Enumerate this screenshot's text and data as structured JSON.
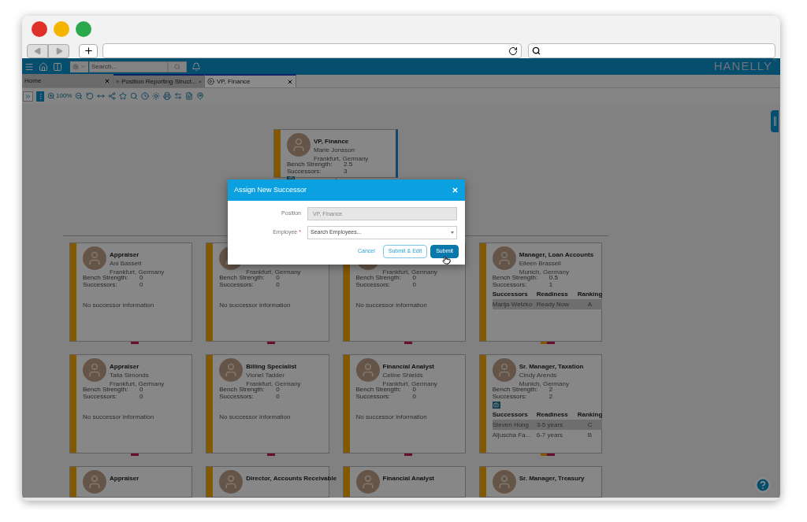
{
  "header": {
    "search_placeholder": "Search...",
    "logo": "HANELLY",
    "logo_mark": "™"
  },
  "tabs": [
    {
      "label": "Home",
      "kind": "home",
      "selected": false
    },
    {
      "label": "Position Reporting Struct...",
      "kind": "page",
      "selected": false
    },
    {
      "label": "VP, Finance",
      "kind": "page",
      "selected": true
    }
  ],
  "toolbar": {
    "zoom": "100%"
  },
  "org_chart": {
    "root": {
      "title": "VP, Finance",
      "name": "Marie Jonsson",
      "location": "Frankfurt, Germany",
      "selected": true,
      "flagged": true,
      "fields": [
        {
          "label": "Bench Strength:",
          "value": "2.5"
        },
        {
          "label": "Successors:",
          "value": "3"
        }
      ]
    },
    "rows": [
      [
        {
          "title": "Appraiser",
          "name": "Ani Bassett",
          "location": "Frankfurt, Germany",
          "selected": false,
          "flagged": false,
          "fields": [
            {
              "label": "Bench Strength:",
              "value": "0"
            },
            {
              "label": "Successors:",
              "value": "0"
            }
          ],
          "note": "No successor information"
        },
        {
          "location": "Frankfurt, Germany",
          "selected": false,
          "flagged": false,
          "fields": [
            {
              "label": "Bench Strength:",
              "value": "0"
            },
            {
              "label": "Successors:",
              "value": "0"
            }
          ],
          "note": "No successor information"
        },
        {
          "location": "Frankfurt, Germany",
          "selected": false,
          "flagged": false,
          "fields": [
            {
              "label": "Bench Strength:",
              "value": "0"
            },
            {
              "label": "Successors:",
              "value": "0"
            }
          ],
          "note": "No successor information"
        },
        {
          "title": "Manager, Loan Accounts",
          "name": "Eileen Brassell",
          "location": "Munich, Germany",
          "selected": false,
          "flagged": false,
          "fields": [
            {
              "label": "Bench Strength:",
              "value": "0.5"
            },
            {
              "label": "Successors:",
              "value": "1"
            }
          ],
          "successor_table": {
            "columns": [
              "Successors",
              "Readiness",
              "Ranking"
            ],
            "rows": [
              {
                "cells": [
                  "Marija Wetzko",
                  "Ready Now",
                  "A"
                ],
                "selected": true
              }
            ]
          }
        }
      ],
      [
        {
          "title": "Appraiser",
          "name": "Talia Simonds",
          "location": "Frankfurt, Germany",
          "selected": false,
          "flagged": false,
          "fields": [
            {
              "label": "Bench Strength:",
              "value": "0"
            },
            {
              "label": "Successors:",
              "value": "0"
            }
          ],
          "note": "No successor information"
        },
        {
          "title": "Billing Specialist",
          "name": "Vionel Tadder",
          "location": "Frankfurt, Germany",
          "selected": false,
          "flagged": false,
          "fields": [
            {
              "label": "Bench Strength:",
              "value": "0"
            },
            {
              "label": "Successors:",
              "value": "0"
            }
          ],
          "note": "No successor information"
        },
        {
          "title": "Financial Analyst",
          "name": "Celine Shields",
          "location": "Frankfurt, Germany",
          "selected": false,
          "flagged": false,
          "fields": [
            {
              "label": "Bench Strength:",
              "value": "0"
            },
            {
              "label": "Successors:",
              "value": "0"
            }
          ],
          "note": "No successor information"
        },
        {
          "title": "Sr. Manager, Taxation",
          "name": "Cindy Arends",
          "location": "Munich, Germany",
          "selected": false,
          "flagged": true,
          "fields": [
            {
              "label": "Bench Strength:",
              "value": "2"
            },
            {
              "label": "Successors:",
              "value": "2"
            }
          ],
          "successor_table": {
            "columns": [
              "Successors",
              "Readiness",
              "Ranking"
            ],
            "rows": [
              {
                "cells": [
                  "Steven Hong",
                  "3-5 years",
                  "C"
                ],
                "selected": true
              },
              {
                "cells": [
                  "Aljuscha Fa...",
                  "6-7 years",
                  "B"
                ],
                "selected": false
              }
            ]
          }
        }
      ],
      [
        {
          "title": "Appraiser",
          "selected": false,
          "flagged": false
        },
        {
          "title": "Director, Accounts Receivable",
          "selected": false,
          "flagged": false
        },
        {
          "title": "Financial Analyst",
          "selected": false,
          "flagged": false
        },
        {
          "title": "Sr. Manager, Treasury",
          "selected": false,
          "flagged": false
        }
      ]
    ]
  },
  "dialog": {
    "title": "Assign New Successor",
    "fields": [
      {
        "label": "Position",
        "kind": "text",
        "value": "VP, Finance",
        "disabled": true
      },
      {
        "label": "Employee",
        "required_mark": "*",
        "kind": "select",
        "placeholder": "Search Employees...",
        "disabled": false
      }
    ],
    "buttons": [
      {
        "label": "Cancel",
        "kind": "link"
      },
      {
        "label": "Submit & Edit",
        "kind": "outline"
      },
      {
        "label": "Submit",
        "kind": "primary"
      }
    ]
  }
}
